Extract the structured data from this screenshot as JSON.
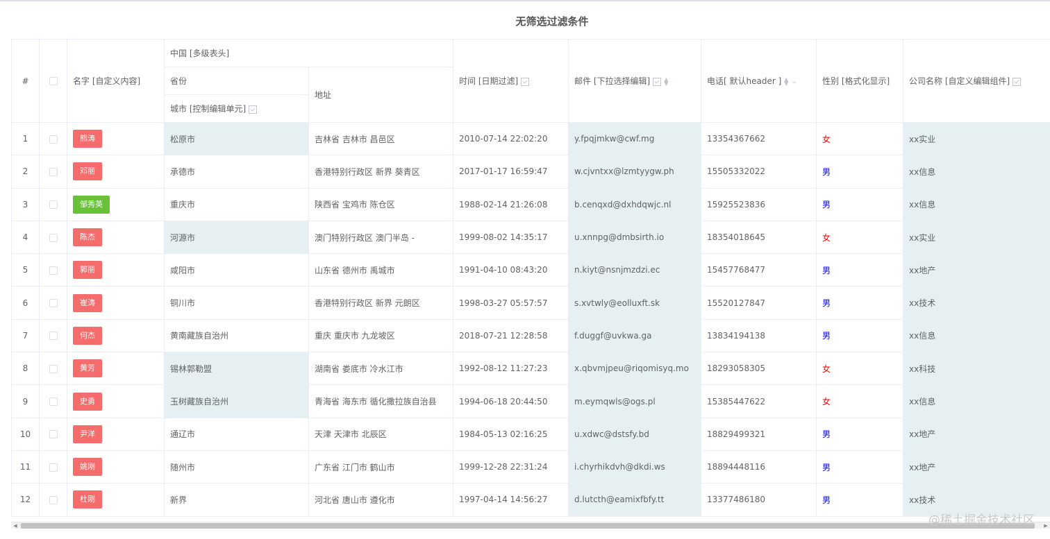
{
  "page": {
    "title": "无筛选过滤条件"
  },
  "columns": {
    "index": "#",
    "name": "名字 [自定义内容]",
    "china_group": "中国 [多级表头]",
    "province": "省份",
    "city": "城市 [控制编辑单元]",
    "address": "地址",
    "time": "时间 [日期过滤]",
    "email": "邮件 [下拉选择编辑]",
    "phone": "电话[ 默认header ]",
    "gender": "性别 [格式化显示]",
    "company": "公司名称 [自定义编辑组件]"
  },
  "rows": [
    {
      "idx": "1",
      "name": "熊涛",
      "tag": "red",
      "city": "松原市",
      "address": "吉林省 吉林市 昌邑区",
      "time": "2010-07-14 22:02:20",
      "email": "y.fpqjmkw@cwf.mg",
      "phone": "13354367662",
      "gender": "女",
      "company": "xx实业"
    },
    {
      "idx": "2",
      "name": "邓丽",
      "tag": "red",
      "city": "承德市",
      "address": "香港特别行政区 新界 葵青区",
      "time": "2017-01-17 16:59:47",
      "email": "w.cjvntxx@lzmtyygw.ph",
      "phone": "15505332022",
      "gender": "男",
      "company": "xx信息"
    },
    {
      "idx": "3",
      "name": "邹秀英",
      "tag": "green",
      "city": "重庆市",
      "address": "陕西省 宝鸡市 陈仓区",
      "time": "1988-02-14 21:26:08",
      "email": "b.cenqxd@dxhdqwjc.nl",
      "phone": "15925523836",
      "gender": "男",
      "company": "xx信息"
    },
    {
      "idx": "4",
      "name": "陈杰",
      "tag": "red",
      "city": "河源市",
      "address": "澳门特别行政区 澳门半岛 -",
      "time": "1999-08-02 14:35:17",
      "email": "u.xnnpg@dmbsirth.io",
      "phone": "18354018645",
      "gender": "女",
      "company": "xx实业"
    },
    {
      "idx": "5",
      "name": "郭丽",
      "tag": "red",
      "city": "咸阳市",
      "address": "山东省 德州市 禹城市",
      "time": "1991-04-10 08:43:20",
      "email": "n.kiyt@nsnjmzdzi.ec",
      "phone": "15457768477",
      "gender": "男",
      "company": "xx地产"
    },
    {
      "idx": "6",
      "name": "崔涛",
      "tag": "red",
      "city": "铜川市",
      "address": "香港特别行政区 新界 元朗区",
      "time": "1998-03-27 05:57:57",
      "email": "s.xvtwly@eolluxft.sk",
      "phone": "15520127847",
      "gender": "男",
      "company": "xx技术"
    },
    {
      "idx": "7",
      "name": "何杰",
      "tag": "red",
      "city": "黄南藏族自治州",
      "address": "重庆 重庆市 九龙坡区",
      "time": "2018-07-21 12:28:58",
      "email": "f.duggf@uvkwa.ga",
      "phone": "13834194138",
      "gender": "男",
      "company": "xx信息"
    },
    {
      "idx": "8",
      "name": "黄芳",
      "tag": "red",
      "city": "锡林郭勒盟",
      "address": "湖南省 娄底市 冷水江市",
      "time": "1992-08-12 11:27:23",
      "email": "x.qbvmjpeu@riqomisyq.mo",
      "phone": "18293058305",
      "gender": "女",
      "company": "xx科技"
    },
    {
      "idx": "9",
      "name": "史勇",
      "tag": "red",
      "city": "玉树藏族自治州",
      "address": "青海省 海东市 循化撒拉族自治县",
      "time": "1994-06-18 20:44:50",
      "email": "m.eymqwls@ogs.pl",
      "phone": "15385447622",
      "gender": "女",
      "company": "xx信息"
    },
    {
      "idx": "10",
      "name": "尹洋",
      "tag": "red",
      "city": "通辽市",
      "address": "天津 天津市 北辰区",
      "time": "1984-05-13 02:16:25",
      "email": "u.xdwc@dstsfy.bd",
      "phone": "18829499321",
      "gender": "男",
      "company": "xx地产"
    },
    {
      "idx": "11",
      "name": "姚刚",
      "tag": "red",
      "city": "随州市",
      "address": "广东省 江门市 鹤山市",
      "time": "1999-12-28 22:31:24",
      "email": "i.chyrhikdvh@dkdi.ws",
      "phone": "18894448116",
      "gender": "男",
      "company": "xx地产"
    },
    {
      "idx": "12",
      "name": "杜刚",
      "tag": "red",
      "city": "新界",
      "address": "河北省 唐山市 遵化市",
      "time": "1997-04-14 14:56:27",
      "email": "d.lutcth@eamixfbfy.tt",
      "phone": "13377486180",
      "gender": "男",
      "company": "xx技术"
    }
  ],
  "highlight_city_rows": [
    0,
    3,
    7,
    8
  ],
  "watermark": "@稀土掘金技术社区",
  "colors": {
    "tag_red": "#f56c6c",
    "tag_green": "#67c23a",
    "highlight": "#e6eff2",
    "female": "#ff0000",
    "male": "#0000ff"
  }
}
